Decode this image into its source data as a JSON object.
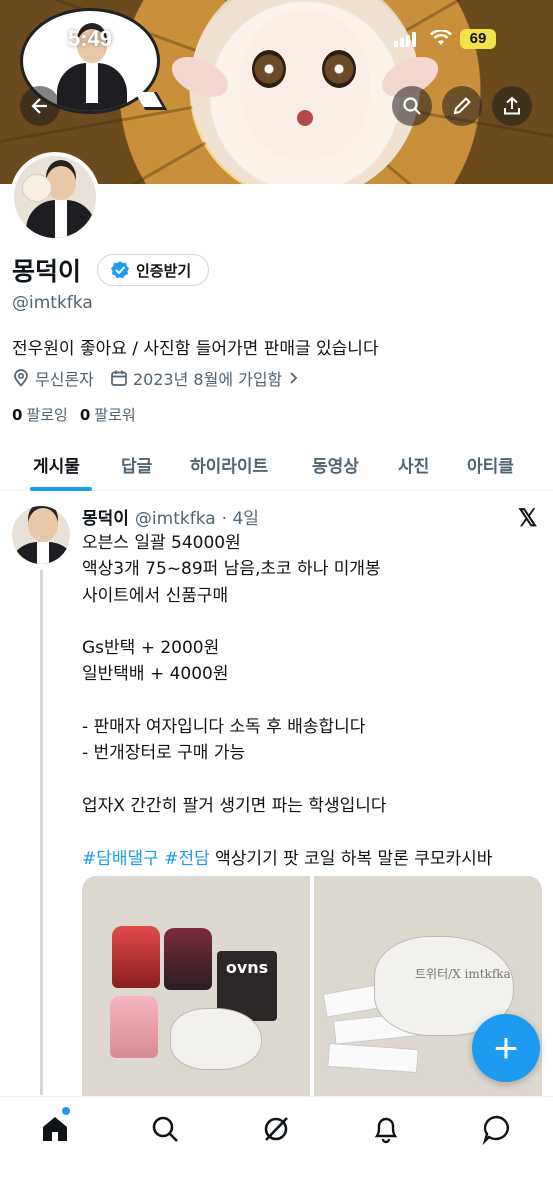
{
  "status_bar": {
    "time": "5:49",
    "battery": "69"
  },
  "profile": {
    "name": "몽덕이",
    "verify_label": "인증받기",
    "handle": "@imtkfka",
    "bio": "전우원이 좋아요 / 사진함 들어가면 판매글 있습니다",
    "location": "무신론자",
    "joined": "2023년 8월에 가입함",
    "following_count": "0",
    "following_label": "팔로잉",
    "followers_count": "0",
    "followers_label": "팔로워"
  },
  "tabs": [
    "게시물",
    "답글",
    "하이라이트",
    "동영상",
    "사진",
    "아티클"
  ],
  "active_tab": "게시물",
  "post": {
    "author": "몽덕이",
    "handle": "@imtkfka",
    "time": "· 4일",
    "lines": [
      "오븐스 일괄 54000원",
      "액상3개 75~89퍼 남음,초코 하나 미개봉",
      "사이트에서 신품구매",
      "",
      "Gs반택 + 2000원",
      "일반택배 + 4000원",
      "",
      "- 판매자 여자입니다 소독 후 배송합니다",
      "- 번개장터로 구매 가능",
      "",
      "업자X 간간히 팔거 생기면 파는 학생입니다",
      ""
    ],
    "hashtags": [
      "#담배댈구",
      "#전담"
    ],
    "tail_text": "액상기기 팟 코일 하복 말론 쿠모카시바",
    "image1_text": "ovns",
    "image2_text": "트위터/X imtkfka"
  },
  "icons": {
    "back": "back-arrow-icon",
    "search": "search-icon",
    "edit": "pencil-icon",
    "share": "share-icon",
    "location": "location-pin-icon",
    "calendar": "calendar-icon",
    "home": "home-icon",
    "explore": "search-icon",
    "grok": "grok-icon",
    "notifications": "bell-icon",
    "messages": "message-icon"
  },
  "colors": {
    "accent": "#1d9bf0",
    "battery": "#f1e24a"
  }
}
